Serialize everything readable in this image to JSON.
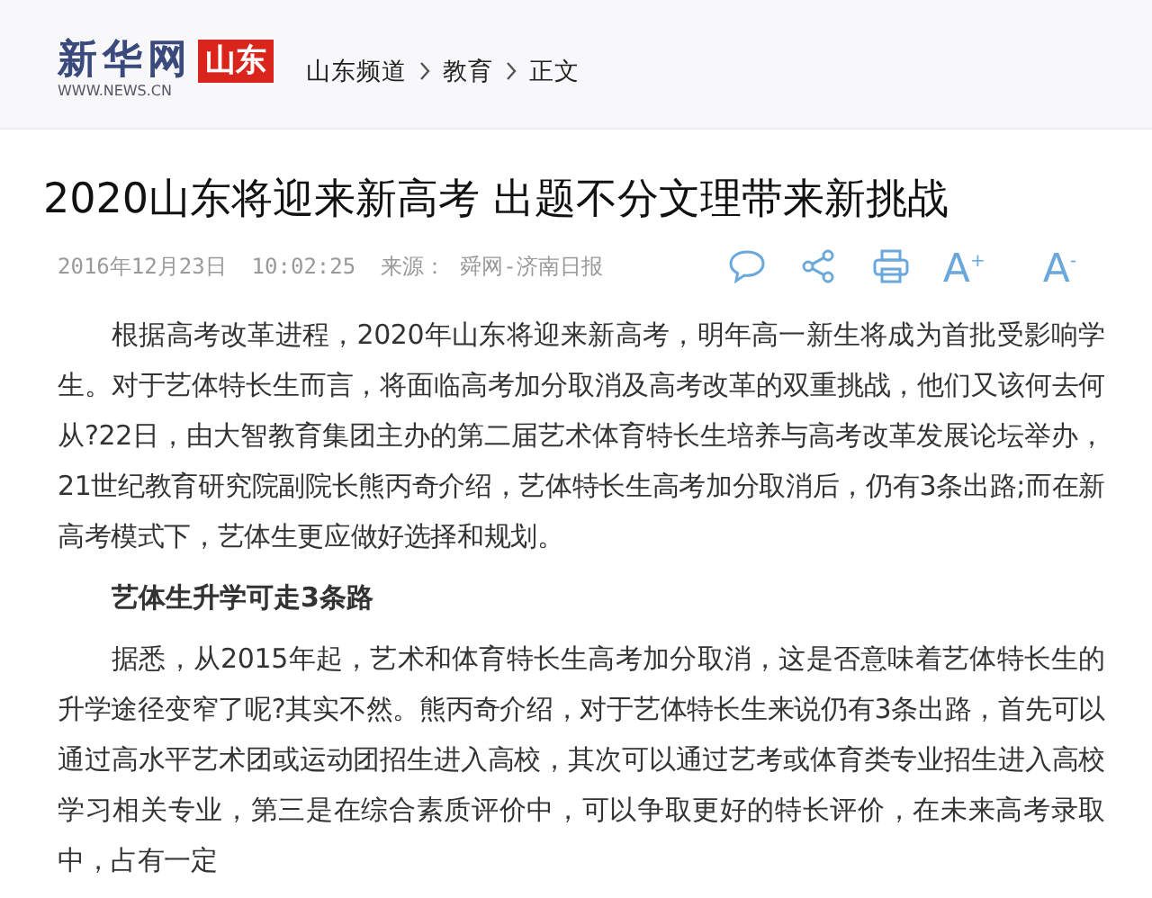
{
  "header": {
    "logo": {
      "name": "新华网",
      "url": "WWW.NEWS.CN",
      "region": "山东"
    },
    "breadcrumb": [
      "山东频道",
      "教育",
      "正文"
    ]
  },
  "article": {
    "title": "2020山东将迎来新高考 出题不分文理带来新挑战",
    "meta": {
      "date": "2016年12月23日",
      "time": "10:02:25",
      "source_label": "来源：",
      "source": "舜网-济南日报"
    },
    "tools": [
      {
        "kind": "comment"
      },
      {
        "kind": "share"
      },
      {
        "kind": "print"
      },
      {
        "kind": "text",
        "label": "A$^{+}$"
      },
      {
        "kind": "text",
        "label": "A$^{-}$"
      }
    ],
    "body": [
      {
        "kind": "paragraph",
        "text": "根据高考改革进程，2020年山东将迎来新高考，明年高一新生将成为首批受影响学生。对于艺体特长生而言，将面临高考加分取消及高考改革的双重挑战，他们又该何去何从?22日，由大智教育集团主办的第二届艺术体育特长生培养与高考改革发展论坛举办，21世纪教育研究院副院长熊丙奇介绍，艺体特长生高考加分取消后，仍有3条出路;而在新高考模式下，艺体生更应做好选择和规划。"
      },
      {
        "kind": "heading",
        "text": "艺体生升学可走3条路"
      },
      {
        "kind": "paragraph",
        "text": "据悉，从2015年起，艺术和体育特长生高考加分取消，这是否意味着艺体特长生的升学途径变窄了呢?其实不然。熊丙奇介绍，对于艺体特长生来说仍有3条出路，首先可以通过高水平艺术团或运动团招生进入高校，其次可以通过艺考或体育类专业招生进入高校学习相关专业，第三是在综合素质评价中，可以争取更好的特长评价，在未来高考录取中，占有一定"
      }
    ]
  }
}
